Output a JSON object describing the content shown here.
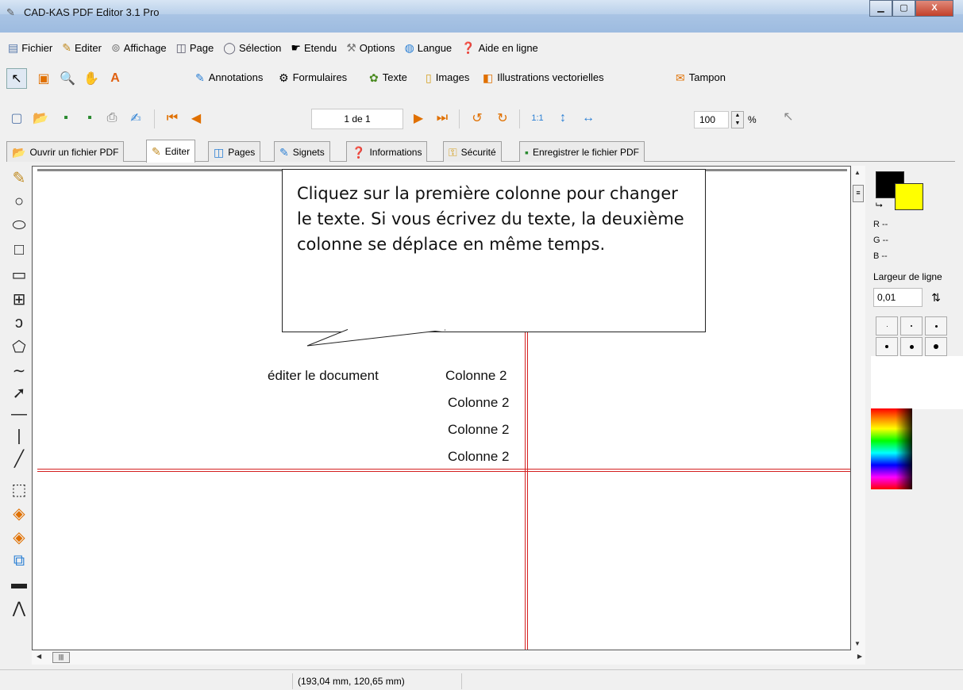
{
  "window": {
    "title": "CAD-KAS PDF Editor 3.1 Pro",
    "controls": [
      "minimize",
      "maximize",
      "close"
    ]
  },
  "menu": {
    "items": [
      {
        "label": "Fichier",
        "icon": "document-icon"
      },
      {
        "label": "Editer",
        "icon": "pen-icon"
      },
      {
        "label": "Affichage",
        "icon": "binoculars-icon"
      },
      {
        "label": "Page",
        "icon": "book-icon"
      },
      {
        "label": "Sélection",
        "icon": "lasso-icon"
      },
      {
        "label": "Etendu",
        "icon": "hand-pointer-icon"
      },
      {
        "label": "Options",
        "icon": "tools-icon"
      },
      {
        "label": "Langue",
        "icon": "globe-icon"
      },
      {
        "label": "Aide en ligne",
        "icon": "help-icon"
      }
    ]
  },
  "toolbar1": {
    "items": [
      {
        "label": "Annotations",
        "icon": "annotation-icon"
      },
      {
        "label": "Formulaires",
        "icon": "form-icon"
      },
      {
        "label": "Texte",
        "icon": "text-icon"
      },
      {
        "label": "Images",
        "icon": "image-icon"
      },
      {
        "label": "Illustrations vectorielles",
        "icon": "vector-icon"
      },
      {
        "label": "Tampon",
        "icon": "stamp-icon"
      }
    ]
  },
  "toolbar2": {
    "page_indicator": "1 de 1",
    "zoom_value": "100",
    "zoom_unit": "%"
  },
  "tabs": [
    {
      "label": "Ouvrir un fichier PDF",
      "icon": "open-folder-icon",
      "active": false
    },
    {
      "label": "Editer",
      "icon": "pen-icon",
      "active": true
    },
    {
      "label": "Pages",
      "icon": "pages-icon",
      "active": false
    },
    {
      "label": "Signets",
      "icon": "bookmark-icon",
      "active": false
    },
    {
      "label": "Informations",
      "icon": "info-icon",
      "active": false
    },
    {
      "label": "Sécurité",
      "icon": "key-icon",
      "active": false
    },
    {
      "label": "Enregistrer le fichier PDF",
      "icon": "save-icon",
      "active": false
    }
  ],
  "document": {
    "callout_text": "Cliquez sur la première colonne pour changer le texte. Si vous écrivez du texte, la deuxième colonne se déplace en même temps.",
    "column1_text": "éditer le document",
    "column2_rows": [
      "Colonne 2",
      "Colonne 2",
      "Colonne 2",
      "Colonne 2"
    ]
  },
  "color_panel": {
    "foreground": "#000000",
    "background": "#ffff00",
    "r_label": "R --",
    "g_label": "G --",
    "b_label": "B --",
    "line_width_label": "Largeur de ligne",
    "line_width_value": "0,01"
  },
  "status": {
    "coordinates": "(193,04 mm, 120,65 mm)"
  }
}
